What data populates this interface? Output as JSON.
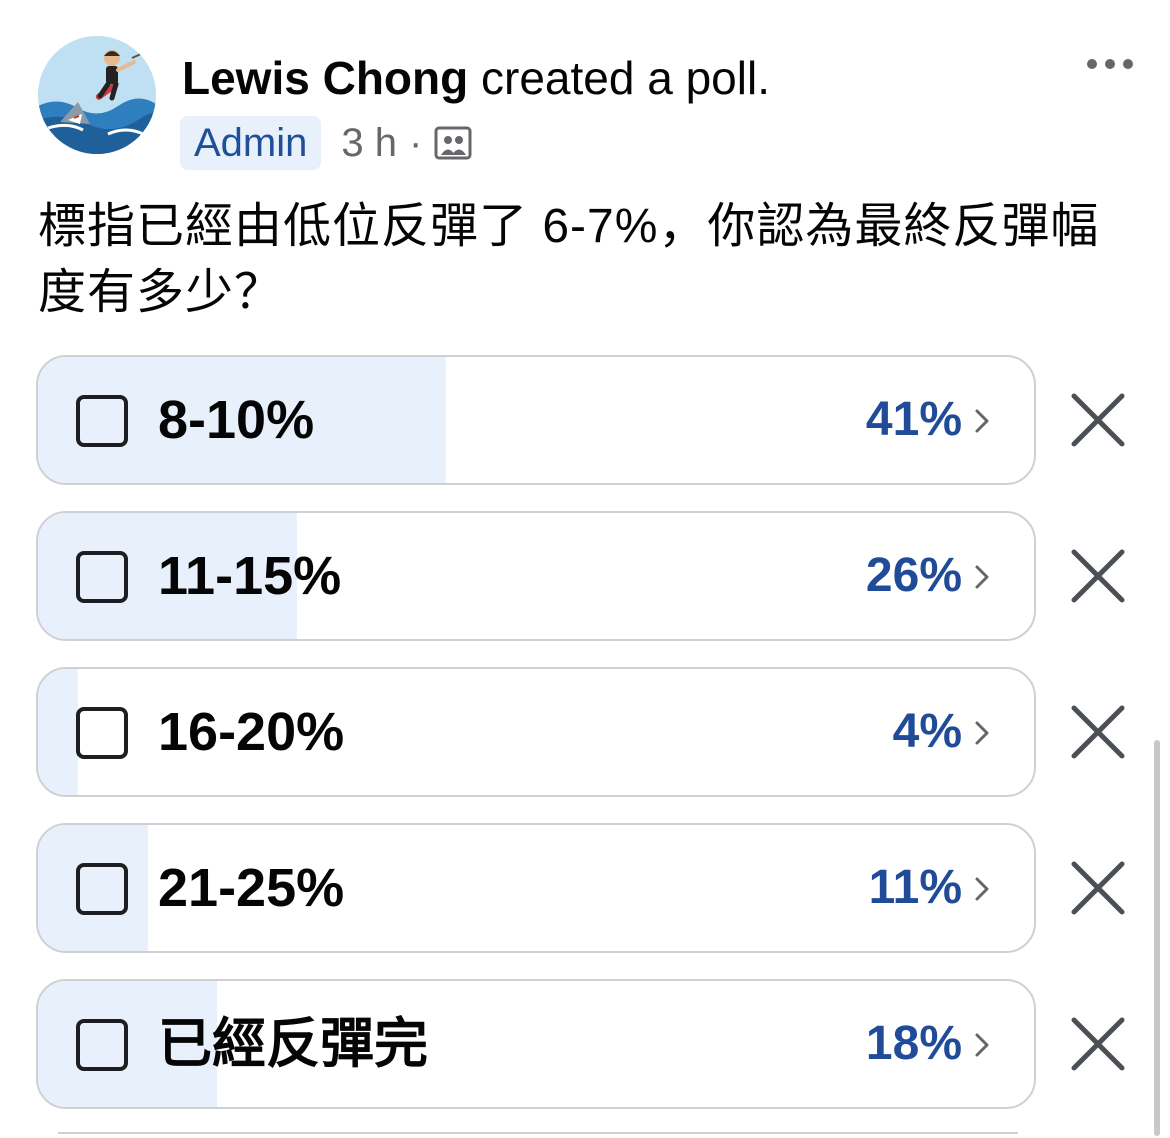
{
  "post": {
    "author": "Lewis Chong",
    "action": "created a poll.",
    "badge": "Admin",
    "time": "3 h",
    "separator": "·",
    "audience_icon": "group-audience-icon",
    "more_icon": "more-options-icon"
  },
  "question": "標指已經由低位反彈了 6-7%，你認為最終反彈幅度有多少？",
  "options": [
    {
      "label": "8-10%",
      "percent_text": "41%",
      "share": 0.41
    },
    {
      "label": "11-15%",
      "percent_text": "26%",
      "share": 0.26
    },
    {
      "label": "16-20%",
      "percent_text": "4%",
      "share": 0.04
    },
    {
      "label": "21-25%",
      "percent_text": "11%",
      "share": 0.11
    },
    {
      "label": "已經反彈完",
      "percent_text": "18%",
      "share": 0.18
    }
  ],
  "icons": {
    "checkbox": "checkbox-icon",
    "chevron": "chevron-right-icon",
    "remove": "close-icon"
  },
  "colors": {
    "accent_text": "#1f4b99",
    "fill": "#e7f0fb",
    "badge_bg": "#e7f0fb",
    "muted_text": "#65676b"
  }
}
